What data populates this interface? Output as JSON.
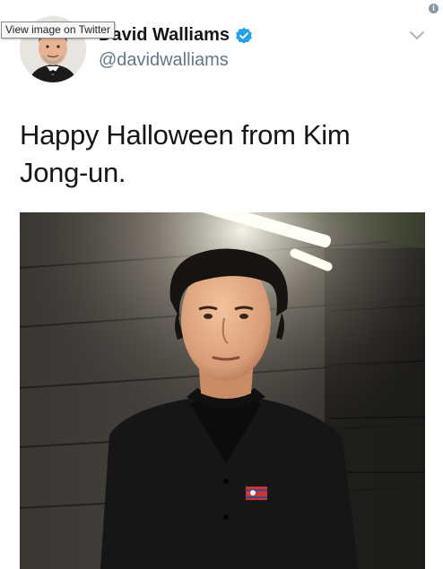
{
  "tooltip": {
    "text": "View image on Twitter"
  },
  "header": {
    "info_icon": "i",
    "display_name": "David Walliams",
    "handle": "@davidwalliams",
    "verified_icon": "verified-badge-icon",
    "chevron_icon": "chevron-down-icon"
  },
  "tweet": {
    "text": "Happy Halloween from Kim Jong-un."
  },
  "colors": {
    "name": "#14171a",
    "handle": "#657786",
    "verified": "#1da1f2",
    "chevron": "#aab8c2",
    "info": "#8899a6"
  }
}
